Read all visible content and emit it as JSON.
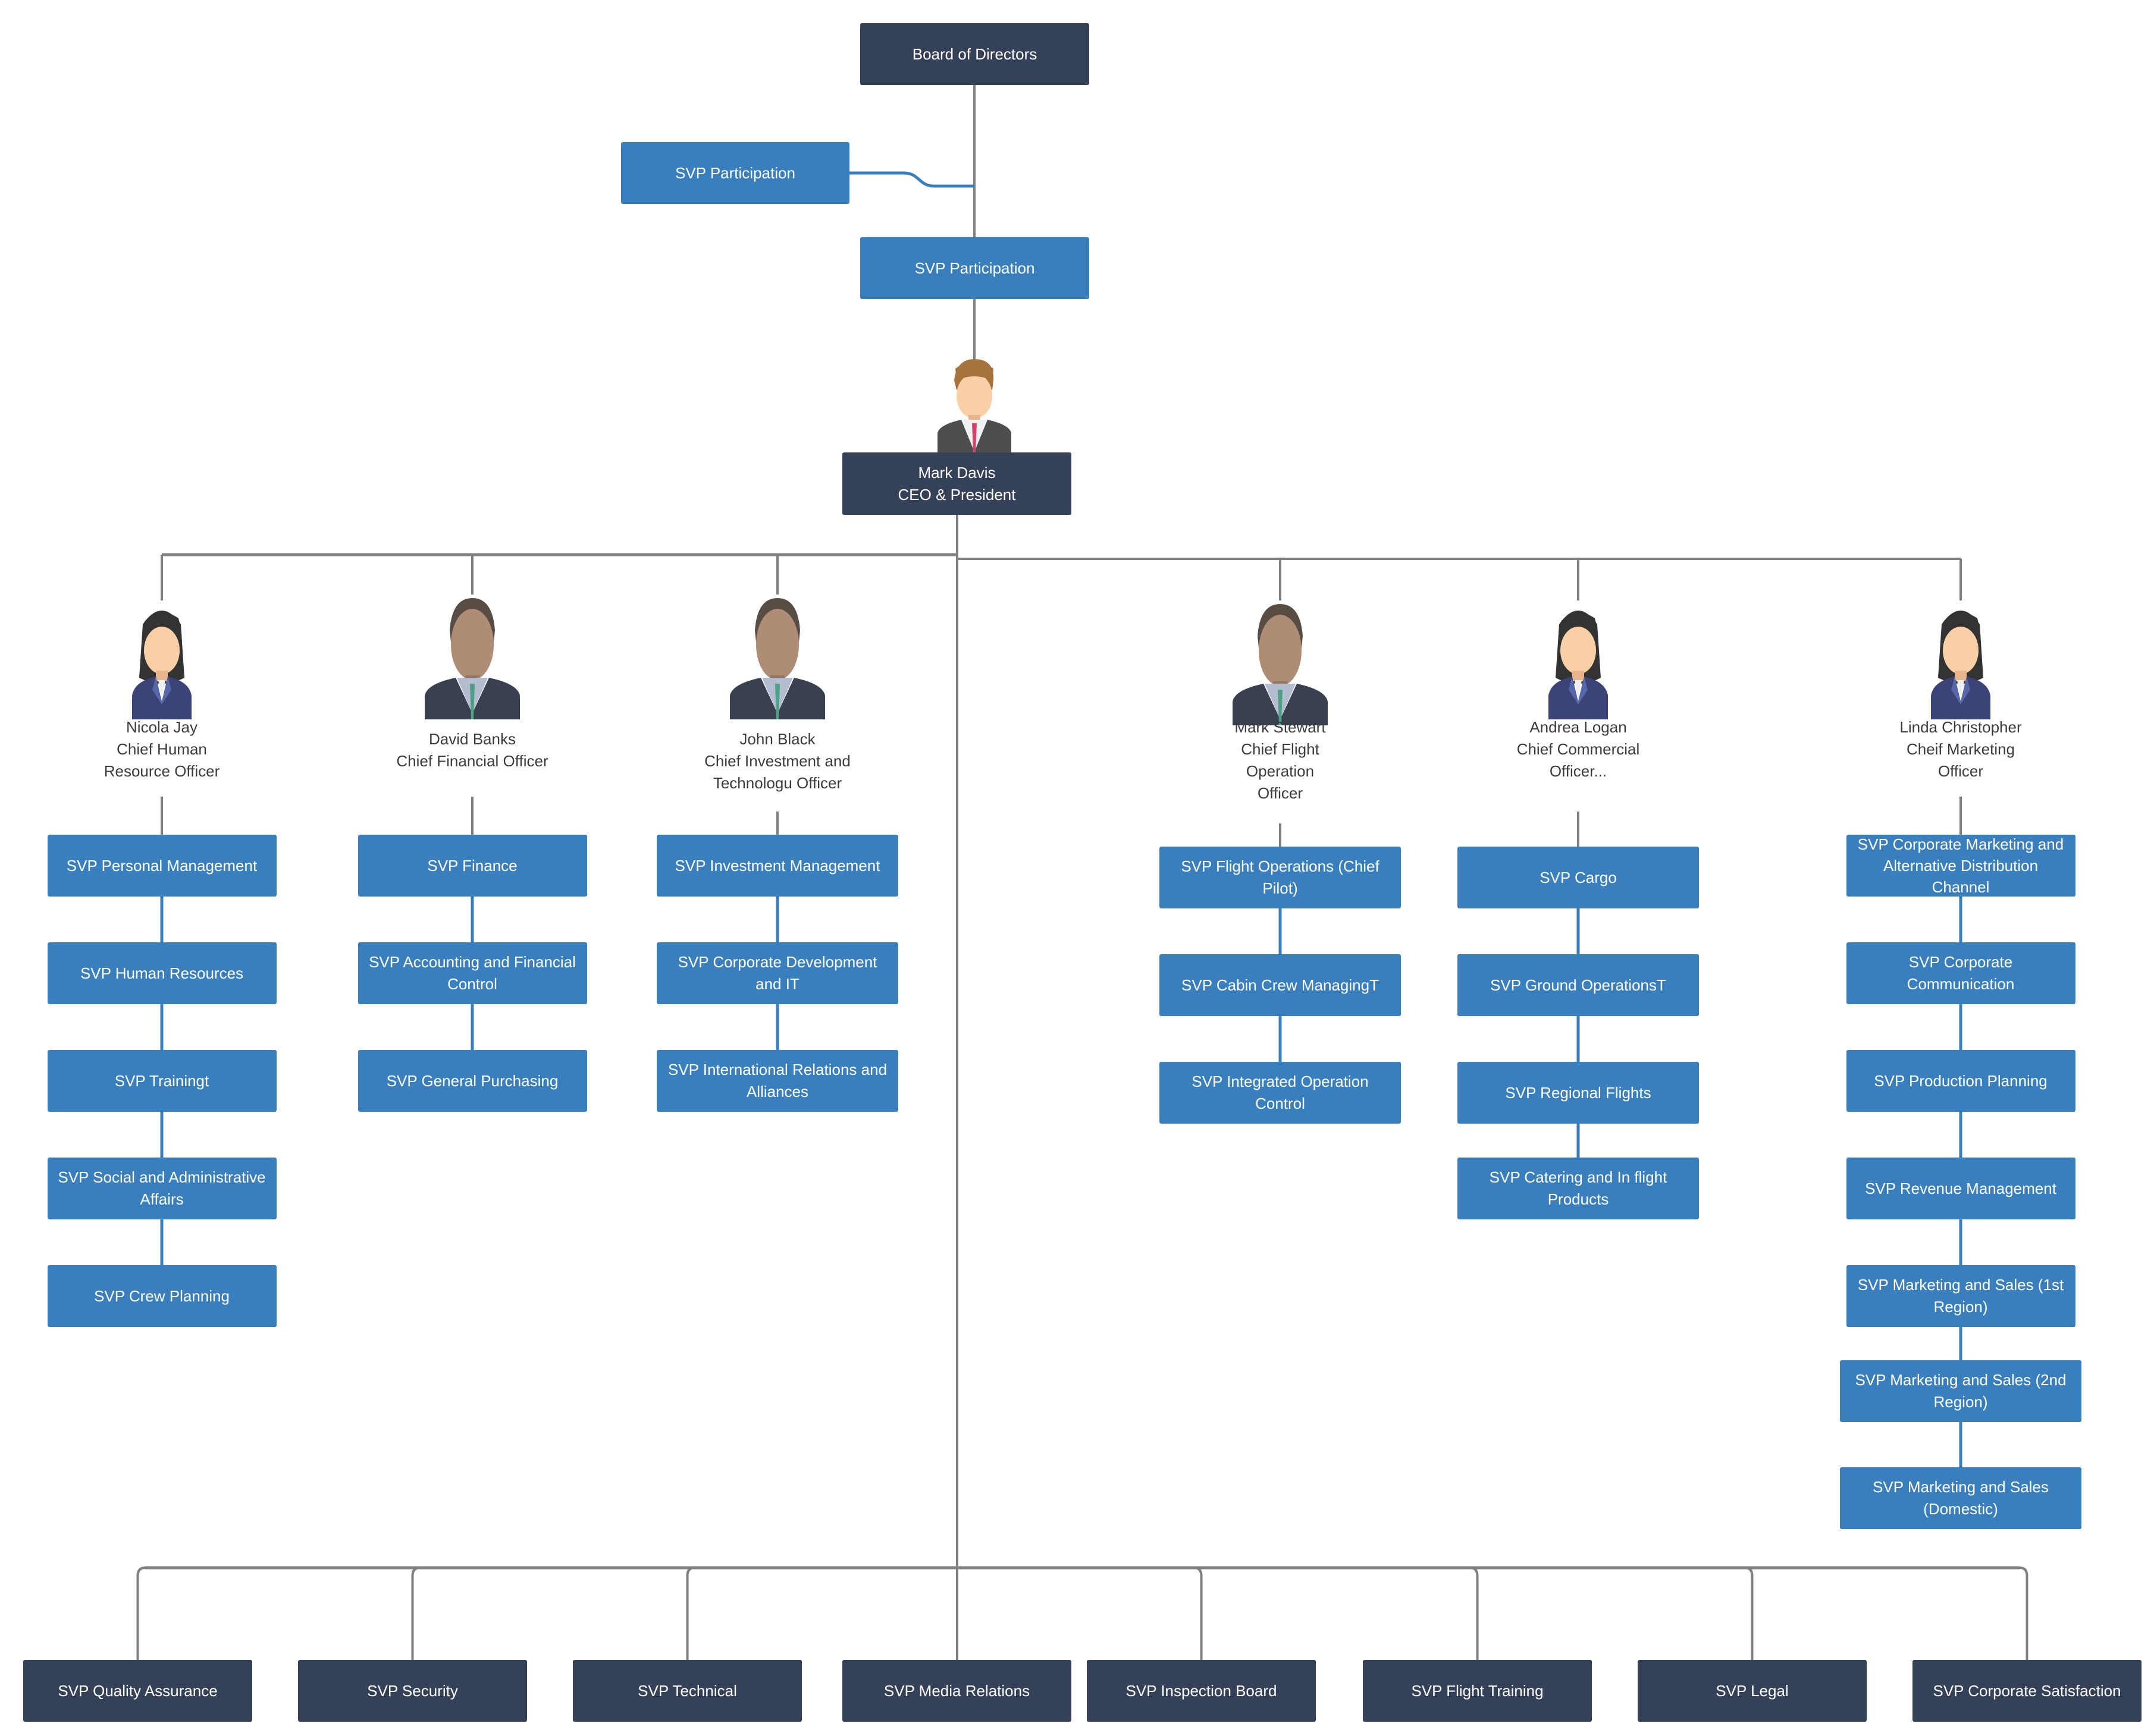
{
  "colors": {
    "dark_box": "#354159",
    "blue_box": "#3a7fbd",
    "connector_gray": "#808080",
    "connector_blue": "#3a7fbd",
    "text_dark": "#3b3b3b"
  },
  "top": {
    "board": "Board of Directors",
    "svp_participation_side": "SVP Participation",
    "svp_participation_main": "SVP Participation",
    "ceo": {
      "name": "Mark Davis",
      "title": "CEO & President",
      "avatar": "man-light-skin-brown-hair-red-tie-icon"
    }
  },
  "executives": [
    {
      "name": "Nicola Jay",
      "title_lines": [
        "Chief Human",
        "Resource Officer"
      ],
      "avatar": "woman-dark-hair-blue-suit-icon",
      "reports": [
        "SVP Personal Management",
        "SVP Human Resources",
        "SVP Trainingt",
        "SVP Social and Administrative Affairs",
        "SVP Crew Planning"
      ]
    },
    {
      "name": "David Banks",
      "title_lines": [
        "Chief Financial Officer"
      ],
      "avatar": "man-dark-skin-green-tie-icon",
      "reports": [
        "SVP Finance",
        "SVP Accounting and Financial Control",
        "SVP General Purchasing"
      ]
    },
    {
      "name": "John Black",
      "title_lines": [
        "Chief Investment and",
        "Technologu Officer"
      ],
      "avatar": "man-dark-skin-green-tie-icon",
      "reports": [
        "SVP Investment Management",
        "SVP Corporate Development and IT",
        "SVP International Relations and Alliances"
      ]
    },
    {
      "name": "Mark Stewart",
      "title_lines": [
        "Chief Flight",
        "Operation",
        "Officer"
      ],
      "avatar": "man-dark-skin-green-tie-icon",
      "reports": [
        "SVP Flight Operations (Chief Pilot)",
        "SVP Cabin Crew ManagingT",
        "SVP Integrated Operation Control"
      ]
    },
    {
      "name": "Andrea Logan",
      "title_lines": [
        "Chief Commercial",
        "Officer..."
      ],
      "avatar": "woman-dark-hair-blue-suit-icon",
      "reports": [
        "SVP Cargo",
        "SVP Ground OperationsT",
        "SVP Regional Flights",
        "SVP Catering and In flight Products"
      ]
    },
    {
      "name": "Linda Christopher",
      "title_lines": [
        "Cheif Marketing",
        "Officer"
      ],
      "avatar": "woman-dark-hair-blue-suit-icon",
      "reports": [
        "SVP Corporate Marketing and Alternative Distribution Channel",
        "SVP Corporate Communication",
        "SVP Production Planning",
        "SVP Revenue Management",
        "SVP Marketing and Sales (1st Region)",
        "SVP Marketing and Sales (2nd Region)",
        "SVP Marketing and Sales (Domestic)"
      ]
    }
  ],
  "bottom_row": [
    "SVP Quality Assurance",
    "SVP Security",
    "SVP Technical",
    "SVP Media Relations",
    "SVP Inspection Board",
    "SVP Flight Training",
    "SVP Legal",
    "SVP Corporate Satisfaction"
  ]
}
